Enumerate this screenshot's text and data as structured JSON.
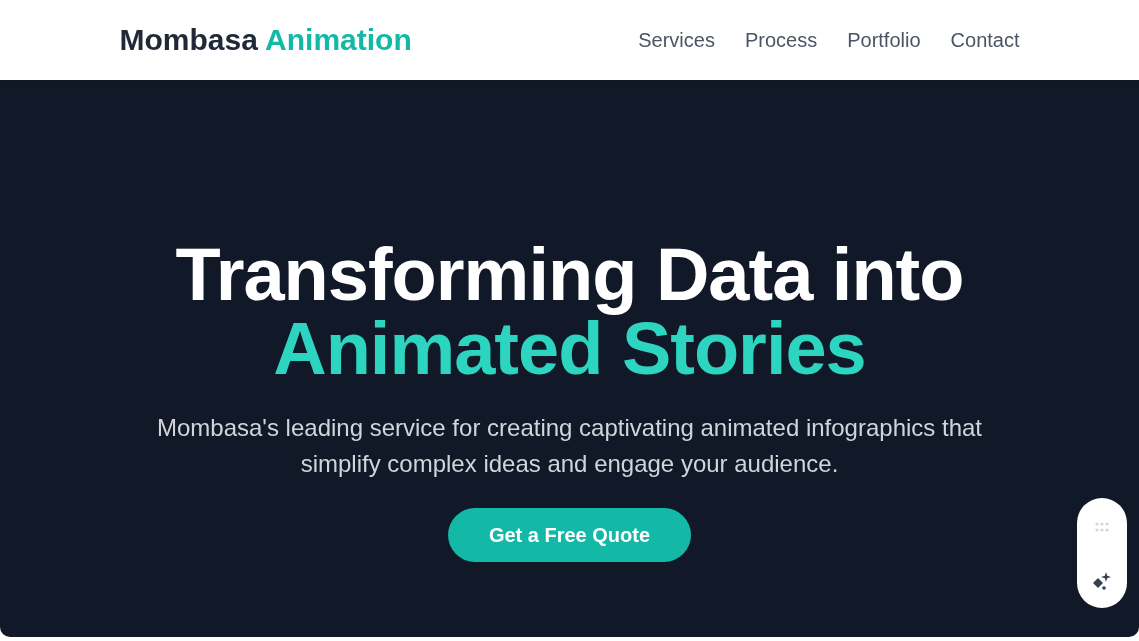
{
  "header": {
    "logo": {
      "name": "Mombasa",
      "accent": "Animation"
    },
    "nav": [
      "Services",
      "Process",
      "Portfolio",
      "Contact"
    ]
  },
  "hero": {
    "headline": "Transforming Data into",
    "headline_accent": "Animated Stories",
    "subtitle": "Mombasa's leading service for creating captivating animated infographics that simplify complex ideas and engage your audience.",
    "cta": "Get a Free Quote"
  }
}
